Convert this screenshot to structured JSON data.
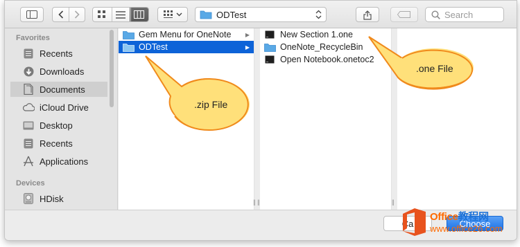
{
  "toolbar": {
    "path_label": "ODTest",
    "search_placeholder": "Search"
  },
  "sidebar": {
    "favorites_header": "Favorites",
    "devices_header": "Devices",
    "favorites": [
      {
        "label": "Recents",
        "icon": "recents-icon"
      },
      {
        "label": "Downloads",
        "icon": "downloads-icon"
      },
      {
        "label": "Documents",
        "icon": "documents-icon",
        "selected": true
      },
      {
        "label": "iCloud Drive",
        "icon": "icloud-icon"
      },
      {
        "label": "Desktop",
        "icon": "desktop-icon"
      },
      {
        "label": "Recents",
        "icon": "recents-icon"
      },
      {
        "label": "Applications",
        "icon": "applications-icon"
      }
    ],
    "devices": [
      {
        "label": "HDisk",
        "icon": "disk-icon"
      }
    ]
  },
  "columns": {
    "col1": [
      {
        "label": "Gem Menu for OneNote",
        "kind": "folder"
      },
      {
        "label": "ODTest",
        "kind": "folder",
        "selected": true
      }
    ],
    "col2": [
      {
        "label": "New Section 1.one",
        "kind": "file"
      },
      {
        "label": "OneNote_RecycleBin",
        "kind": "folder"
      },
      {
        "label": "Open Notebook.onetoc2",
        "kind": "file"
      }
    ]
  },
  "buttons": {
    "cancel": "Ca",
    "choose": "Choose"
  },
  "callouts": {
    "zip": ".zip File",
    "one": ".one File"
  },
  "watermark": {
    "line1_orange": "Office",
    "line1_blue": "教程网",
    "line2": "www.office26.com"
  },
  "colors": {
    "selection": "#0d63d8",
    "callout_fill": "#ffe07a",
    "callout_stroke": "#f08a1c",
    "folder": "#5aa9e6"
  }
}
